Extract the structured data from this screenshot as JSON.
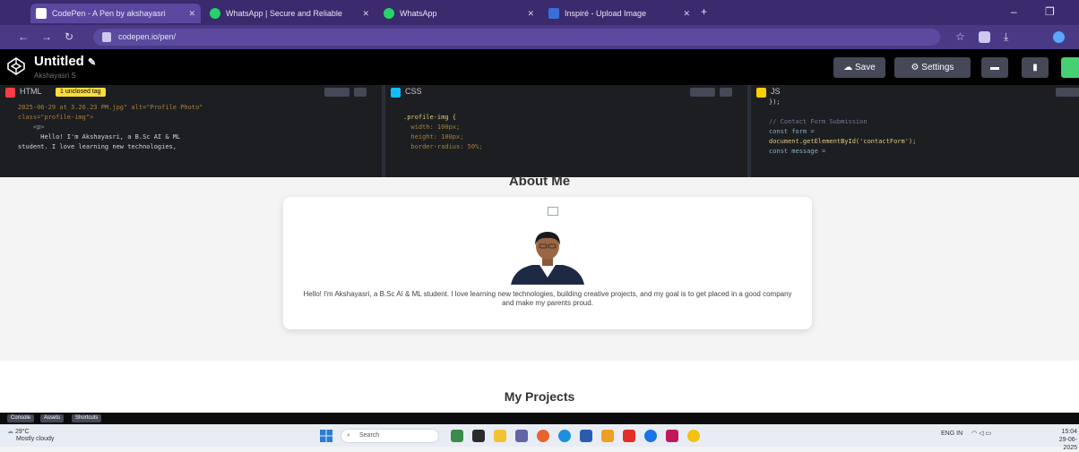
{
  "browser": {
    "tabs": [
      {
        "title": "CodePen - A Pen by akshayasri",
        "active": true
      },
      {
        "title": "WhatsApp | Secure and Reliable",
        "active": false
      },
      {
        "title": "WhatsApp",
        "active": false
      },
      {
        "title": "Inspiré - Upload Image",
        "active": false
      }
    ],
    "url": "codepen.io/pen/"
  },
  "codepen": {
    "title": "Untitled",
    "author": "Akshayasri S",
    "save_label": "Save",
    "settings_label": "Settings"
  },
  "editors": {
    "html": {
      "name": "HTML",
      "error_badge": "1 unclosed tag",
      "lines": [
        "2025-06-29 at 3.26.23 PM.jpg\" alt=\"Profile Photo\"",
        "class=\"profile-img\">",
        "    <p>",
        "      Hello! I'm Akshayasri, a B.Sc AI & ML",
        "student. I love learning new technologies,"
      ]
    },
    "css": {
      "name": "CSS",
      "lines": [
        "",
        ".profile-img {",
        "  width: 100px;",
        "  height: 100px;",
        "  border-radius: 50%;"
      ]
    },
    "js": {
      "name": "JS",
      "lines": [
        "});",
        "",
        "// Contact Form Submission",
        "const form =",
        "document.getElementById('contactForm');",
        "const message ="
      ]
    }
  },
  "preview": {
    "about_title": "About Me",
    "about_text": "Hello! I'm Akshayasri, a B.Sc AI & ML student. I love learning new technologies, building creative projects, and my goal is to get placed in a good company and make my parents proud.",
    "projects_title": "My Projects"
  },
  "bottom_bar": {
    "buttons": [
      "Console",
      "Assets",
      "Shortcuts"
    ]
  },
  "taskbar": {
    "weather_temp": "29°C",
    "weather_desc": "Mostly cloudy",
    "search_label": "Search",
    "lang": "ENG",
    "lang_region": "IN",
    "time": "15:04",
    "date": "29-06-2025"
  },
  "colors": {
    "browser_frame": "#3b2a6d",
    "codepen_header": "#000000",
    "editor_bg": "#1d1e22",
    "html_badge": "#ff3c41",
    "css_badge": "#0ebeff",
    "js_badge": "#fcd000",
    "error_badge": "#ffdd40",
    "preview_bg": "#f4f4f4"
  }
}
